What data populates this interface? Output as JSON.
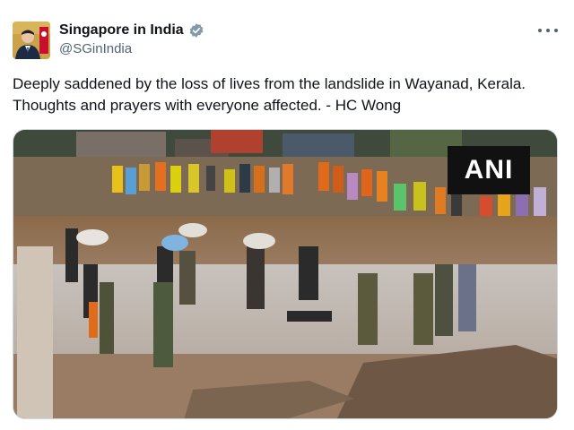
{
  "account": {
    "display_name": "Singapore in India",
    "handle": "@SGinIndia",
    "verified": true,
    "verified_color": "#829aab"
  },
  "tweet": {
    "text": "Deeply saddened by the loss of lives from the landslide in Wayanad, Kerala. Thoughts and prayers with everyone affected. - HC Wong"
  },
  "media": {
    "watermark": "ANI"
  },
  "icons": {
    "more": "more-options-icon",
    "verified": "verified-badge-icon"
  }
}
